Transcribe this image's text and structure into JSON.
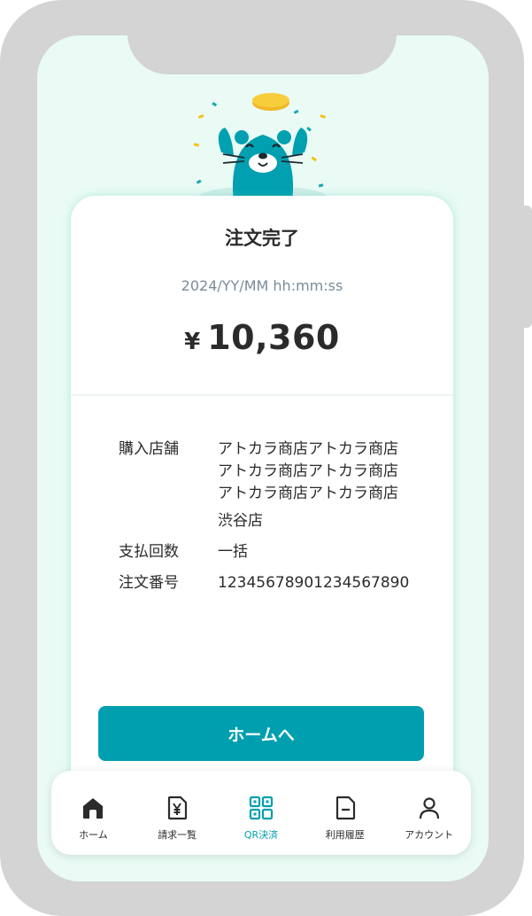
{
  "receipt": {
    "title": "注文完了",
    "datetime": "2024/YY/MM hh:mm:ss",
    "currency_symbol": "¥",
    "amount": "10,360"
  },
  "details": {
    "store": {
      "label": "購入店舗",
      "lines": [
        "アトカラ商店アトカラ商店",
        "アトカラ商店アトカラ商店",
        "アトカラ商店アトカラ商店"
      ],
      "branch": "渋谷店"
    },
    "payment_count": {
      "label": "支払回数",
      "value": "一括"
    },
    "order_number": {
      "label": "注文番号",
      "value": "12345678901234567890"
    }
  },
  "home_button_label": "ホームへ",
  "tabbar": {
    "active": "qr",
    "items": [
      {
        "id": "home",
        "label": "ホーム",
        "icon": "home-icon"
      },
      {
        "id": "bills",
        "label": "請求一覧",
        "icon": "bill-yen-icon"
      },
      {
        "id": "qr",
        "label": "QR決済",
        "icon": "qr-icon"
      },
      {
        "id": "history",
        "label": "利用履歴",
        "icon": "document-icon"
      },
      {
        "id": "account",
        "label": "アカウント",
        "icon": "user-icon"
      }
    ]
  },
  "colors": {
    "accent": "#009fb0",
    "screen_background": "#e9fbf4",
    "frame": "#d4d4d4"
  }
}
